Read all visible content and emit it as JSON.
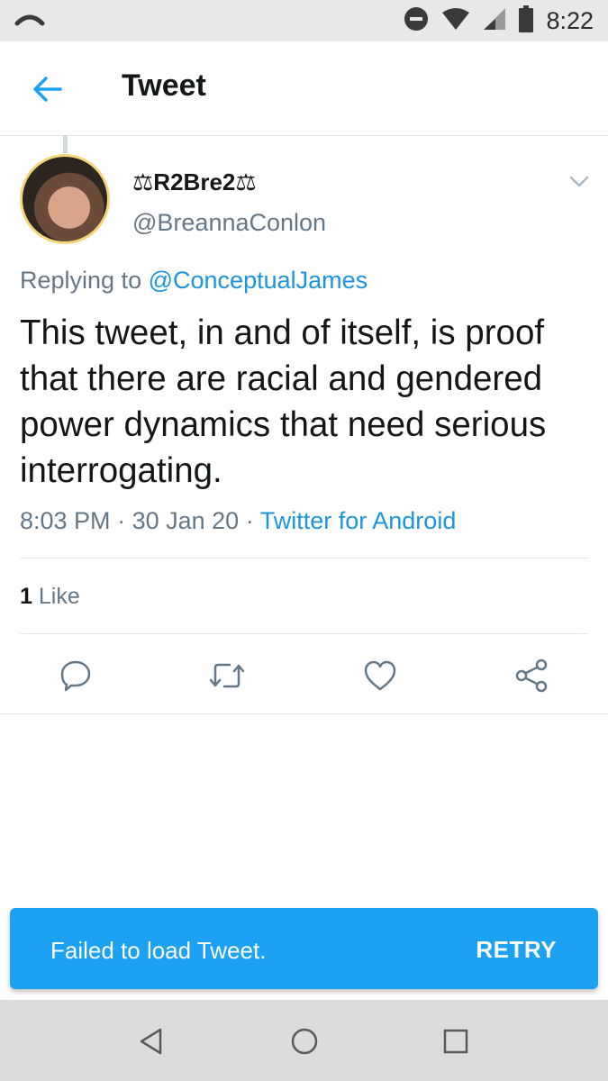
{
  "status_bar": {
    "time": "8:22",
    "icons": [
      "signal-arc-icon",
      "do-not-disturb-icon",
      "wifi-icon",
      "cell-signal-icon",
      "battery-icon"
    ]
  },
  "header": {
    "title": "Tweet",
    "back_icon": "arrow-left-icon"
  },
  "tweet": {
    "display_name": "⚖R2Bre2⚖",
    "handle": "@BreannaConlon",
    "replying_to_label": "Replying to",
    "replying_to_handle": "@ConceptualJames",
    "text": "This tweet, in and of itself, is proof that there are racial and gendered power dynamics that need serious interrogating.",
    "time": "8:03 PM",
    "date": "30 Jan 20",
    "separator": "·",
    "source": "Twitter for Android",
    "like_count": "1",
    "like_label": "Like"
  },
  "actions": [
    "reply-icon",
    "retweet-icon",
    "like-icon",
    "share-icon"
  ],
  "snackbar": {
    "message": "Failed to load Tweet.",
    "action": "RETRY"
  },
  "navigation": [
    "back-triangle-icon",
    "home-circle-icon",
    "recents-square-icon"
  ],
  "colors": {
    "accent": "#1da1f2",
    "link": "#1b95e0",
    "secondary_text": "#657786",
    "primary_text": "#14171a"
  }
}
